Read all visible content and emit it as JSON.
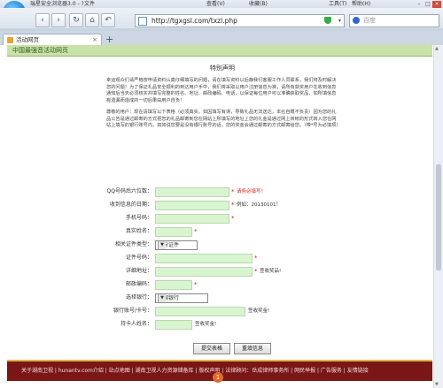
{
  "window": {
    "app_title": "瑞星安全浏览器3.0 - ?",
    "menu": [
      "文件",
      "查看(V)",
      "收藏(B)",
      "工具(T)",
      "帮助(H)"
    ]
  },
  "toolbar": {
    "back_glyph": "‹",
    "forward_glyph": "›",
    "refresh_glyph": "↻",
    "home_glyph": "⌂",
    "undo_glyph": "↶",
    "url": "http://tgxgsl.com/txzl.php",
    "search_placeholder": "百度"
  },
  "tabs": [
    {
      "label": "活动网页",
      "close": "×"
    }
  ],
  "new_tab_glyph": "+",
  "page": {
    "header": "中国最强音活动网页",
    "section_title": "特别声明",
    "paragraph1": "幸运观众们请严格按申请资料认真仔细填写的问题，请在填写资料以后静我们客服工作人员联系，我们将及时解决您的问题！为了保证礼品安全顺利的到达用户手中，我们将采取以用户注册信息为准，请所有获奖用户在收到信息通知后当天必须核实并填写完整的姓名、地址、邮政编码、电话，以保证每位用户可以准确获取奖品，如所填信息有遗漏而造成的一切后果由用户自负！",
    "paragraph2": "尊敬的用户：现在请填写以下表格（必须真实，如因填写有误，导致礼品无法送达，本社自概不负责）因为您的礼品公告是通过邮寄的方式把您的礼品邮寄到您在网站上所填写的地址上您的礼金是通过网上转帐的形式转入您在网站上填写的银行账号内，如如说您要是没有银行账号的话，您的奖金会通过邮寄的方式邮寄给您。（带*号为必填项）",
    "form": {
      "qq_label": "QQ号码后六位数：",
      "qq_hint": "请务必填写！",
      "date_label": "收到信息的日期：",
      "date_hint": "例如：20130101！",
      "phone_label": "手机号码：",
      "name_label": "真实姓名：",
      "idtype_label": "相关证件类型：",
      "idtype_value": "身份证件",
      "idno_label": "证件号码：",
      "address_label": "详细地址：",
      "address_hint": "签收奖品!",
      "postcode_label": "邮政编码：",
      "bank_label": "选择银行：",
      "bank_value": "中国银行",
      "account_label": "银行账号/卡号：",
      "account_hint": "签收奖金!",
      "holder_label": "持卡人姓名：",
      "holder_hint": "签收奖金!",
      "required_mark": "*"
    },
    "submit_button": "提交表格",
    "reset_button": "重填信息",
    "footer_links": "关于湖南卫视 | hunantv.com介绍 | 站点地图 | 湖南卫视人力资源储备库 | 版权声明 | 法律顾问：岳成律师事务所 | 网民举报 | 广告服务 | 友情链接",
    "footer_badge": "1"
  }
}
